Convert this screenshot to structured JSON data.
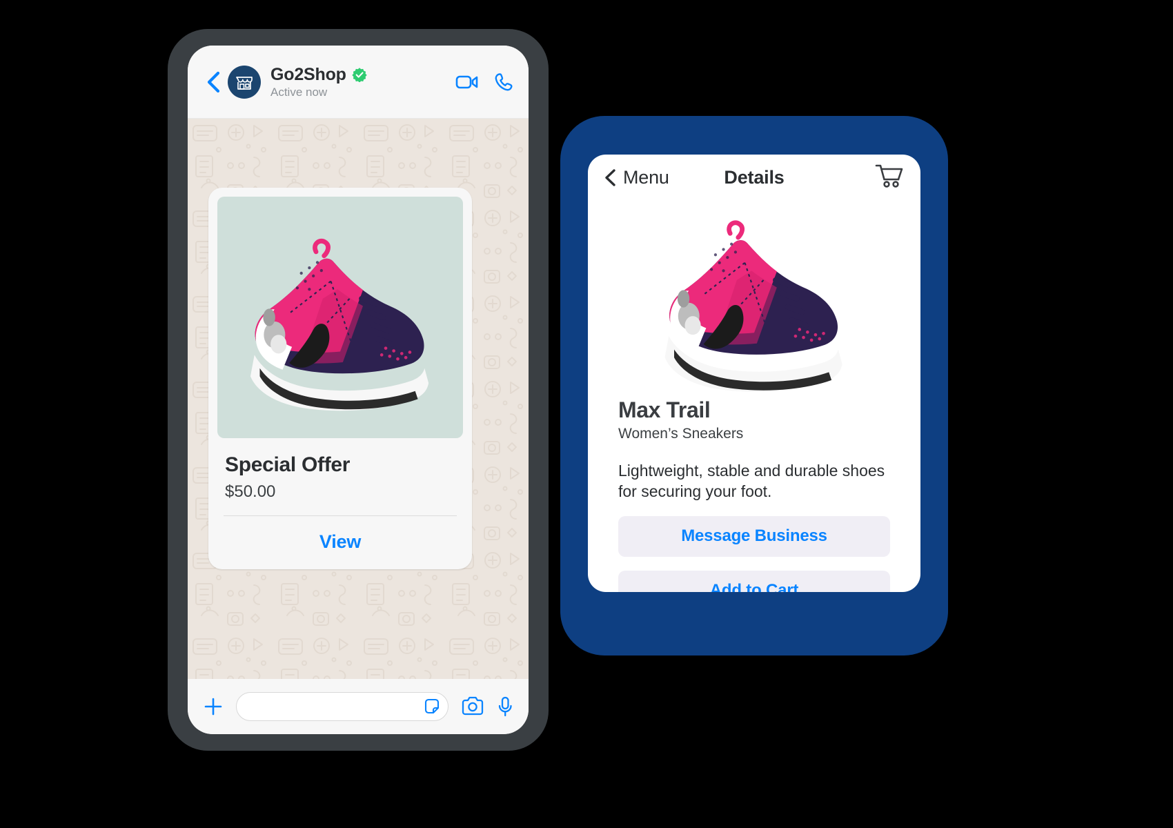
{
  "chat": {
    "header": {
      "back_icon": "chevron-left-icon",
      "avatar_icon": "storefront-icon",
      "business_name": "Go2Shop",
      "verified_icon": "verified-badge-icon",
      "status": "Active now",
      "video_icon": "video-camera-icon",
      "call_icon": "phone-icon"
    },
    "product_message": {
      "image_alt": "pink-navy-sneaker",
      "title": "Special Offer",
      "price": "$50.00",
      "action_label": "View"
    },
    "composer": {
      "add_icon": "plus-icon",
      "input_value": "",
      "input_placeholder": "",
      "sticker_icon": "sticker-icon",
      "camera_icon": "camera-icon",
      "mic_icon": "microphone-icon"
    }
  },
  "details_panel": {
    "header": {
      "back_icon": "chevron-left-icon",
      "back_label": "Menu",
      "title": "Details",
      "cart_icon": "shopping-cart-icon"
    },
    "product": {
      "image_alt": "pink-navy-sneaker",
      "name": "Max Trail",
      "category": "Women’s Sneakers",
      "description": "Lightweight, stable and durable shoes for securing your foot.",
      "primary_action": "Message Business",
      "secondary_action": "Add to Cart"
    }
  },
  "colors": {
    "brand_blue": "#0a84ff",
    "card_blue": "#0e3f82",
    "verified_green": "#2ecc71",
    "wallpaper": "#ece5de",
    "image_bg": "#cfdfda",
    "button_bg": "#f0eef5"
  }
}
